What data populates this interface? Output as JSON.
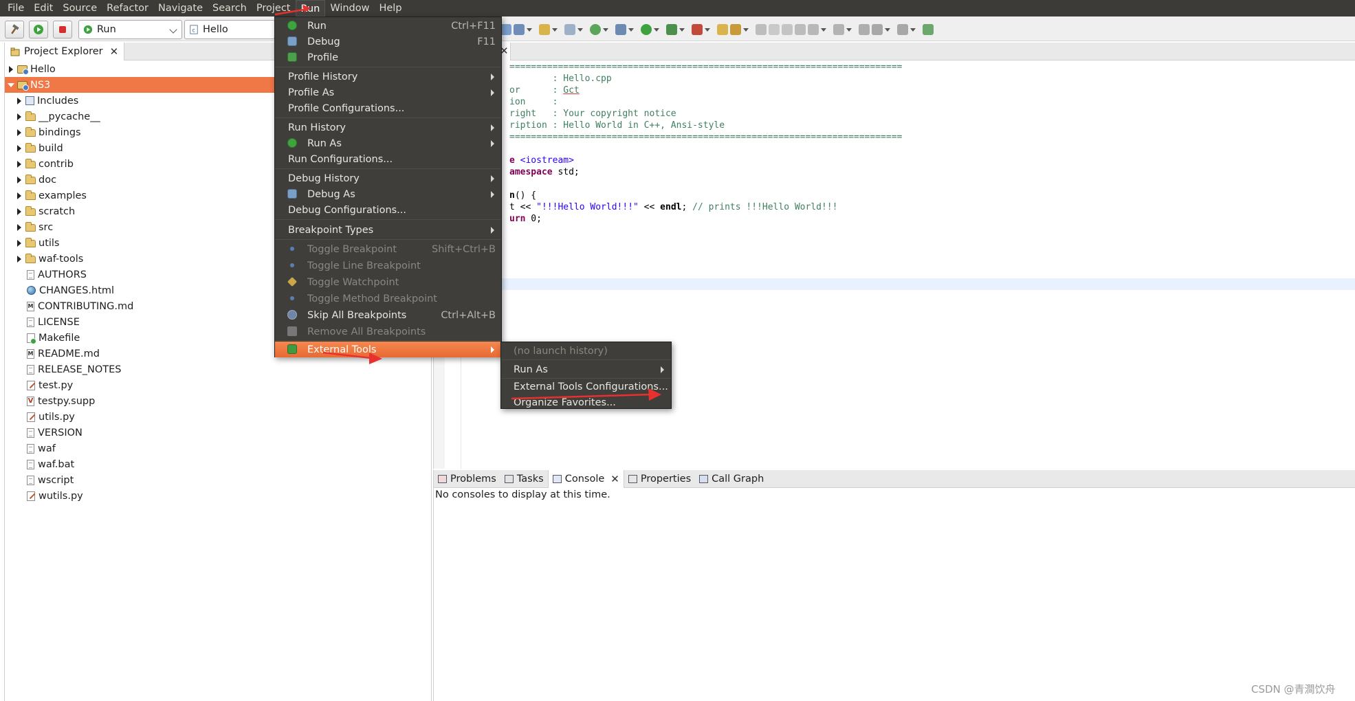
{
  "menubar": {
    "items": [
      "File",
      "Edit",
      "Source",
      "Refactor",
      "Navigate",
      "Search",
      "Project",
      "Run",
      "Window",
      "Help"
    ]
  },
  "toolbar": {
    "launch_mode": "Run",
    "launch_config": "Hello"
  },
  "project_explorer": {
    "title": "Project Explorer",
    "items": [
      {
        "label": "Hello",
        "icon": "project-icon",
        "expandable": true,
        "expanded": false
      },
      {
        "label": "NS3",
        "icon": "project-icon",
        "expandable": true,
        "expanded": true,
        "selected": true
      },
      {
        "label": "Includes",
        "icon": "includes-icon",
        "expandable": true
      },
      {
        "label": "__pycache__",
        "icon": "folder-icon",
        "expandable": true
      },
      {
        "label": "bindings",
        "icon": "folder-icon",
        "expandable": true
      },
      {
        "label": "build",
        "icon": "folder-icon",
        "expandable": true
      },
      {
        "label": "contrib",
        "icon": "folder-icon",
        "expandable": true
      },
      {
        "label": "doc",
        "icon": "folder-icon",
        "expandable": true
      },
      {
        "label": "examples",
        "icon": "folder-icon",
        "expandable": true
      },
      {
        "label": "scratch",
        "icon": "folder-icon",
        "expandable": true
      },
      {
        "label": "src",
        "icon": "folder-icon",
        "expandable": true
      },
      {
        "label": "utils",
        "icon": "folder-icon",
        "expandable": true
      },
      {
        "label": "waf-tools",
        "icon": "folder-icon",
        "expandable": true
      },
      {
        "label": "AUTHORS",
        "icon": "file-icon"
      },
      {
        "label": "CHANGES.html",
        "icon": "html-file-icon"
      },
      {
        "label": "CONTRIBUTING.md",
        "icon": "markdown-file-icon"
      },
      {
        "label": "LICENSE",
        "icon": "file-icon"
      },
      {
        "label": "Makefile",
        "icon": "makefile-icon"
      },
      {
        "label": "README.md",
        "icon": "markdown-file-icon"
      },
      {
        "label": "RELEASE_NOTES",
        "icon": "file-icon"
      },
      {
        "label": "test.py",
        "icon": "python-file-icon"
      },
      {
        "label": "testpy.supp",
        "icon": "supp-file-icon"
      },
      {
        "label": "utils.py",
        "icon": "python-file-icon"
      },
      {
        "label": "VERSION",
        "icon": "file-icon"
      },
      {
        "label": "waf",
        "icon": "file-icon"
      },
      {
        "label": "waf.bat",
        "icon": "file-icon"
      },
      {
        "label": "wscript",
        "icon": "file-icon"
      },
      {
        "label": "wutils.py",
        "icon": "python-file-icon"
      }
    ]
  },
  "editor": {
    "lines": [
      "=========================================================================",
      "        : Hello.cpp",
      "or      : Gct",
      "ion     :",
      "right   : Your copyright notice",
      "ription : Hello World in C++, Ansi-style",
      "=========================================================================",
      "",
      "e <iostream>",
      "amespace std;",
      "",
      "n() {",
      "t << \"!!!Hello World!!!\" << endl; // prints !!!Hello World!!!",
      "urn 0;"
    ],
    "line_parts": {
      "l8a": "e ",
      "l8b": "<iostream>",
      "l9a": "amespace",
      "l9b": " std;",
      "l11a": "n",
      "l11b": "() {",
      "l12a": "t << ",
      "l12b": "\"!!!Hello World!!!\"",
      "l12c": " << ",
      "l12d": "endl",
      "l12e": "; ",
      "l12f": "// prints !!!Hello World!!!",
      "l13a": "urn",
      "l13b": " 0;",
      "l1a": "        : Hello.cpp",
      "l2a": "or      : ",
      "l2b": "Gct"
    }
  },
  "console_view": {
    "tabs": [
      "Problems",
      "Tasks",
      "Console",
      "Properties",
      "Call Graph"
    ],
    "active_tab": "Console",
    "message": "No consoles to display at this time."
  },
  "run_menu": {
    "items": [
      {
        "label": "Run",
        "shortcut": "Ctrl+F11",
        "icon": "run-icon"
      },
      {
        "label": "Debug",
        "shortcut": "F11",
        "icon": "debug-icon"
      },
      {
        "label": "Profile",
        "shortcut": "",
        "icon": "profile-icon"
      },
      {
        "label": "Profile History",
        "submenu": true
      },
      {
        "label": "Profile As",
        "submenu": true
      },
      {
        "label": "Profile Configurations..."
      },
      {
        "label": "Run History",
        "submenu": true
      },
      {
        "label": "Run As",
        "submenu": true,
        "icon": "run-icon"
      },
      {
        "label": "Run Configurations..."
      },
      {
        "label": "Debug History",
        "submenu": true
      },
      {
        "label": "Debug As",
        "submenu": true,
        "icon": "debug-icon"
      },
      {
        "label": "Debug Configurations..."
      },
      {
        "label": "Breakpoint Types",
        "submenu": true
      },
      {
        "label": "Toggle Breakpoint",
        "shortcut": "Shift+Ctrl+B",
        "disabled": true
      },
      {
        "label": "Toggle Line Breakpoint",
        "disabled": true
      },
      {
        "label": "Toggle Watchpoint",
        "disabled": true
      },
      {
        "label": "Toggle Method Breakpoint",
        "disabled": true
      },
      {
        "label": "Skip All Breakpoints",
        "shortcut": "Ctrl+Alt+B"
      },
      {
        "label": "Remove All Breakpoints",
        "disabled": true
      },
      {
        "label": "External Tools",
        "submenu": true,
        "highlighted": true
      }
    ]
  },
  "external_tools_menu": {
    "items": [
      {
        "label": "(no launch history)",
        "disabled": true
      },
      {
        "label": "Run As",
        "submenu": true
      },
      {
        "label": "External Tools Configurations..."
      },
      {
        "label": "Organize Favorites..."
      }
    ]
  },
  "watermark": "CSDN @青澗饮舟",
  "colors": {
    "menubar_bg": "#3c3b37",
    "menu_bg": "#3f3e3a",
    "highlight": "#f07746",
    "annotation_arrow": "#e8312e"
  }
}
